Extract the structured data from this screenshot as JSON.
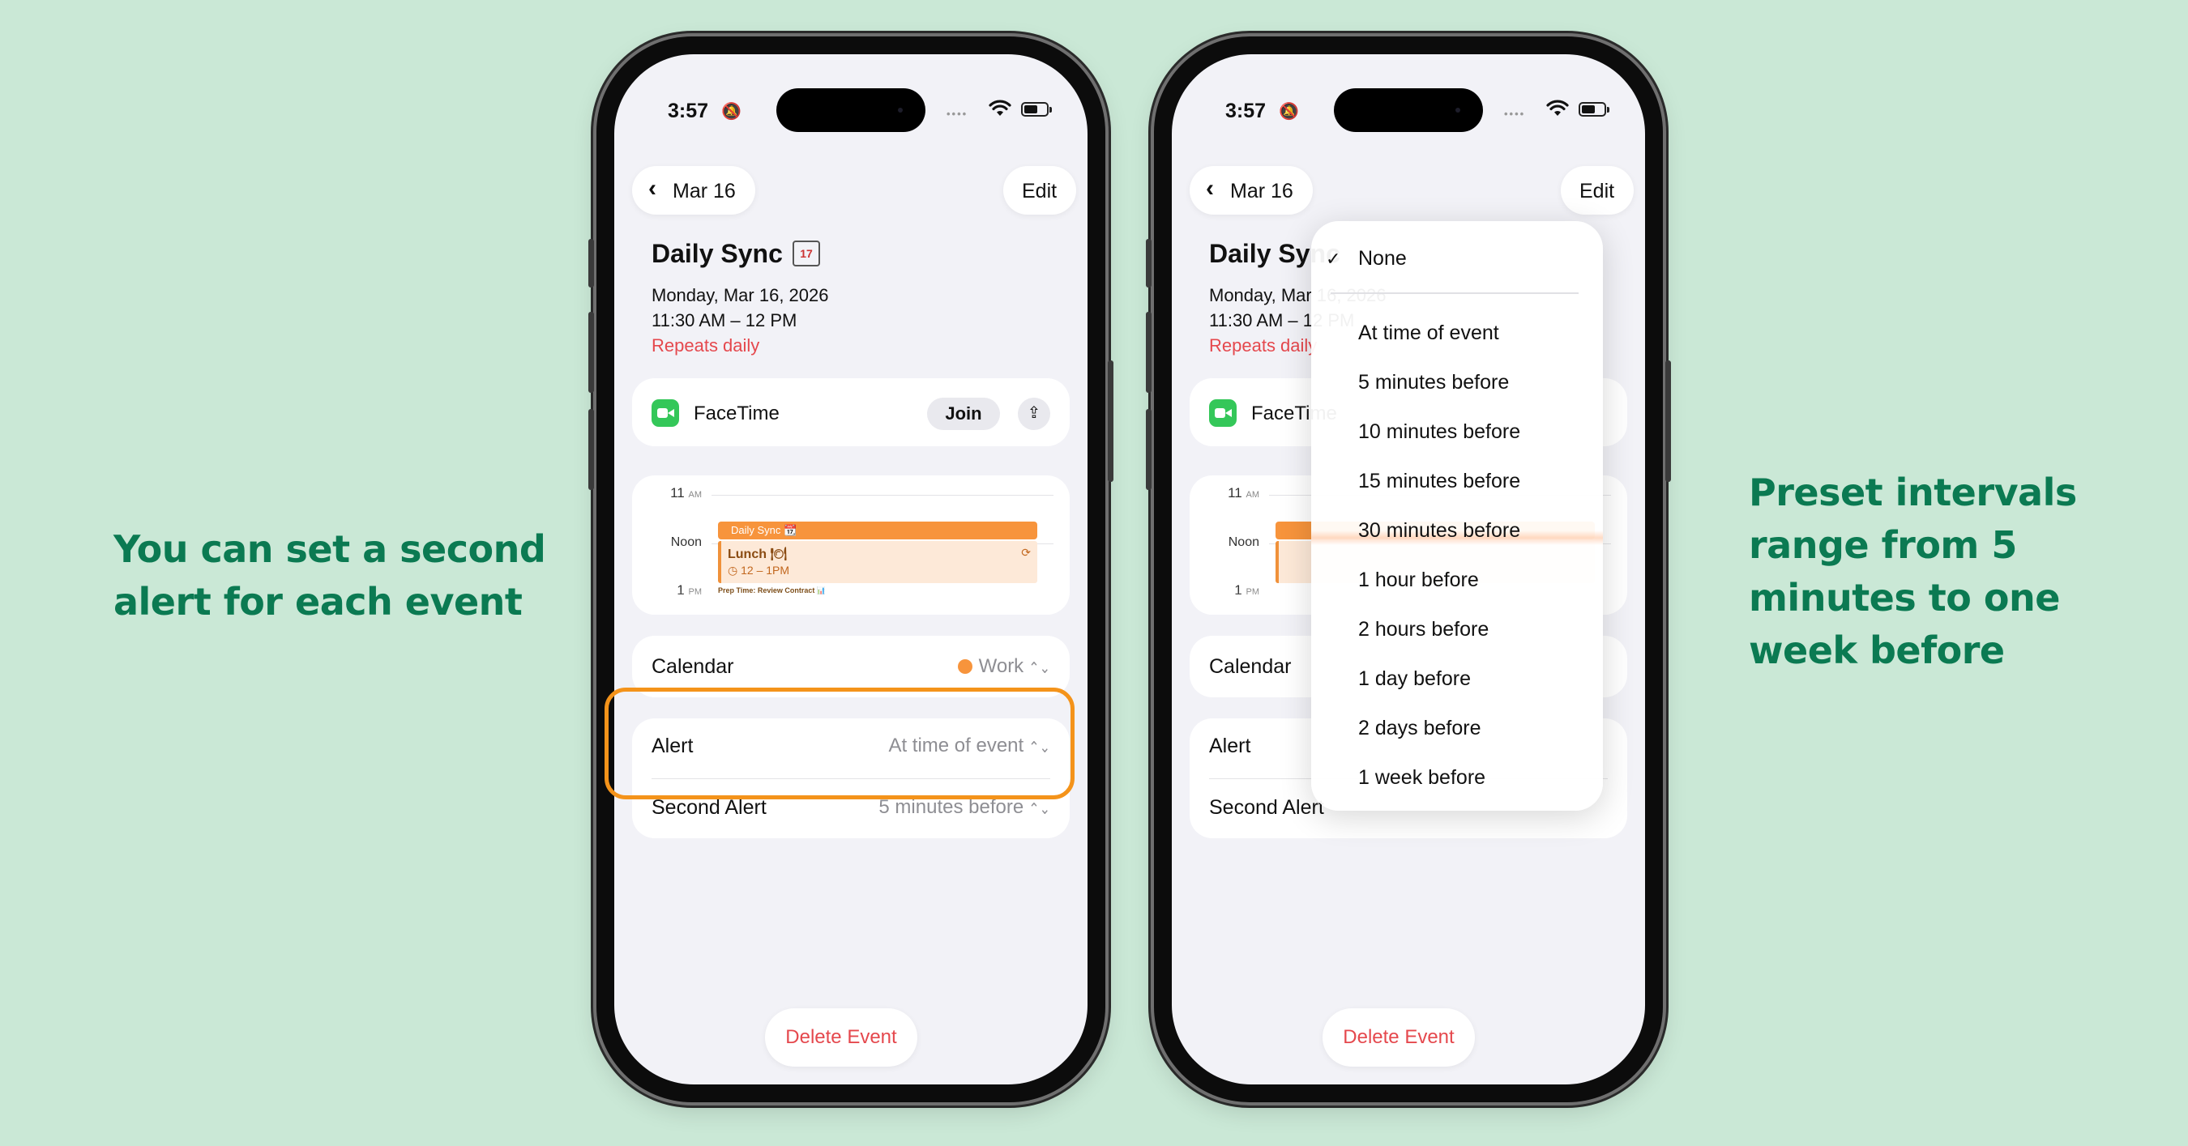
{
  "captions": {
    "left": "You can set a second alert for each event",
    "right": "Preset intervals range from 5 minutes to one week before"
  },
  "status_bar": {
    "time": "3:57"
  },
  "nav": {
    "back_label": "Mar 16",
    "edit_label": "Edit"
  },
  "event": {
    "title": "Daily Sync",
    "date": "Monday, Mar 16, 2026",
    "time": "11:30 AM – 12 PM",
    "repeat": "Repeats daily"
  },
  "facetime": {
    "label": "FaceTime",
    "join_label": "Join"
  },
  "day_preview": {
    "hour_11": "11",
    "hour_11_suffix": "AM",
    "noon": "Noon",
    "hour_1": "1",
    "hour_1_suffix": "PM",
    "events": [
      {
        "title": "Daily Sync 📆"
      },
      {
        "title": "Lunch 🍽",
        "time": "12 – 1PM"
      },
      {
        "title": "Prep Time: Review Contract 📊"
      }
    ]
  },
  "calendar_row": {
    "label": "Calendar",
    "value": "Work",
    "color": "#f7943c"
  },
  "alert_row": {
    "label": "Alert",
    "value": "At time of event"
  },
  "second_alert_row": {
    "label": "Second Alert",
    "value": "5 minutes before"
  },
  "delete_label": "Delete Event",
  "highlight_color": "#f4931a",
  "alert_menu": {
    "selected": "None",
    "options": [
      "None",
      "At time of event",
      "5 minutes before",
      "10 minutes before",
      "15 minutes before",
      "30 minutes before",
      "1 hour before",
      "2 hours before",
      "1 day before",
      "2 days before",
      "1 week before"
    ]
  }
}
